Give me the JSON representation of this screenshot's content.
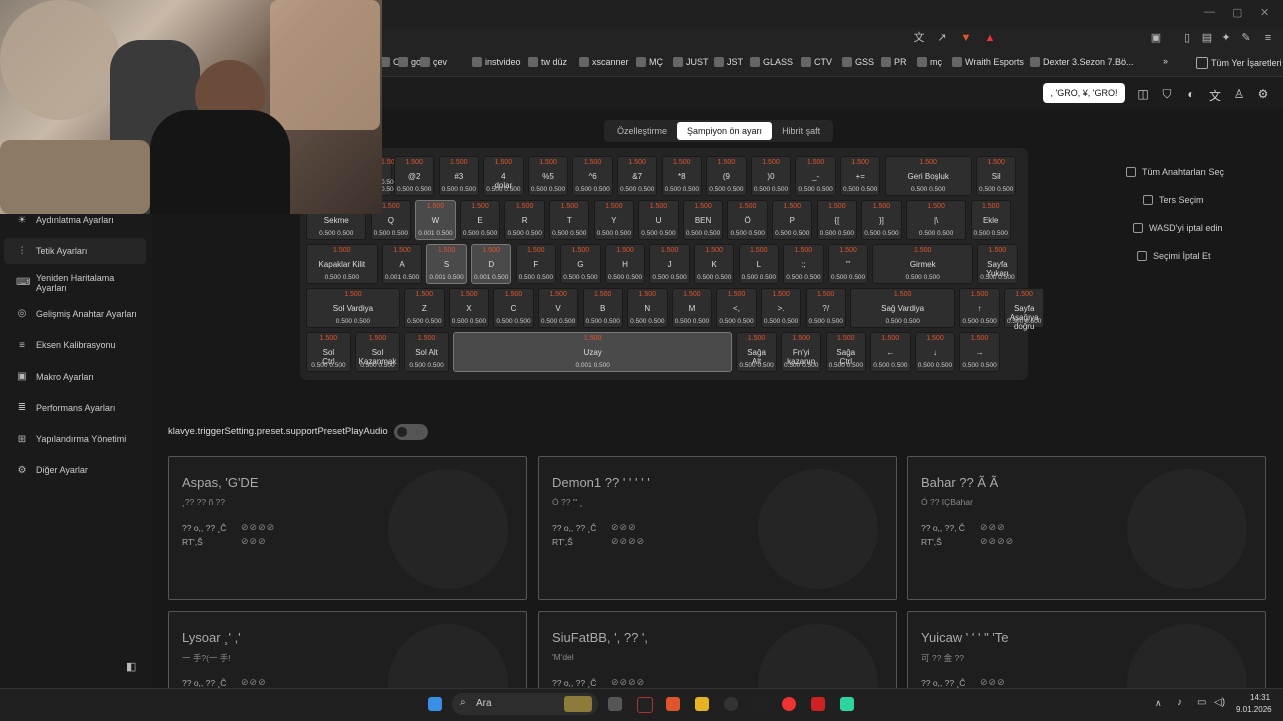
{
  "browser": {
    "bookmarks": [
      {
        "label": "C",
        "icon": "bookmark-icon"
      },
      {
        "label": "go",
        "icon": "google-icon"
      },
      {
        "label": "çev",
        "icon": "doc-icon"
      },
      {
        "label": "instvideo",
        "icon": "download-icon"
      },
      {
        "label": "tw düz",
        "icon": "globe-icon"
      },
      {
        "label": "xscanner",
        "icon": "scanner-icon"
      },
      {
        "label": "MÇ",
        "icon": "match-icon"
      },
      {
        "label": "JUST",
        "icon": "globe-icon"
      },
      {
        "label": "JST",
        "icon": "grid-icon"
      },
      {
        "label": "GLASS",
        "icon": "glass-icon"
      },
      {
        "label": "CTV",
        "icon": "tv-icon"
      },
      {
        "label": "GSS",
        "icon": "shirt-icon"
      },
      {
        "label": "PR",
        "icon": "p-icon"
      },
      {
        "label": "mç",
        "icon": "folder-icon"
      },
      {
        "label": "Wraith Esports",
        "icon": "wraith-icon"
      },
      {
        "label": "Dexter 3.Sezon 7.Bö...",
        "icon": "video-icon"
      }
    ],
    "more_bookmarks": "»",
    "all_bookmarks": "Tüm Yer İşaretleri"
  },
  "header": {
    "badge": ", 'GRO, ¥, 'GRO!"
  },
  "mode_tabs": [
    "Özelleştirme",
    "Şampiyon ön ayarı",
    "Hibrit şaft"
  ],
  "keyboard": {
    "rows": [
      [
        {
          "k": "",
          "v": "1.500",
          "r": "0.500 0.500",
          "w": 8
        },
        {
          "k": "@2",
          "v": "1.500",
          "r": "0.500 0.500"
        },
        {
          "k": "#3",
          "v": "1.500",
          "r": "0.500 0.500"
        },
        {
          "k": "4\ndolar",
          "v": "1.500",
          "r": "0.500 0.500"
        },
        {
          "k": "%5",
          "v": "1.500",
          "r": "0.500 0.500"
        },
        {
          "k": "^6",
          "v": "1.500",
          "r": "0.500 0.500"
        },
        {
          "k": "&7",
          "v": "1.500",
          "r": "0.500 0.500"
        },
        {
          "k": "*8",
          "v": "1.500",
          "r": "0.500 0.500"
        },
        {
          "k": "(9",
          "v": "1.500",
          "r": "0.500 0.500"
        },
        {
          "k": ")0",
          "v": "1.500",
          "r": "0.500 0.500"
        },
        {
          "k": "_-",
          "v": "1.500",
          "r": "0.500 0.500"
        },
        {
          "k": "+=",
          "v": "1.500",
          "r": "0.500 0.500"
        },
        {
          "k": "Geri Boşluk",
          "v": "1.500",
          "r": "0.500 0.500",
          "w": 2.05
        },
        {
          "k": "Sil",
          "v": "1.500",
          "r": "0.500 0.500"
        }
      ],
      [
        {
          "k": "Sekme",
          "v": "",
          "r": "0.500 0.500",
          "w": 1.45
        },
        {
          "k": "Q",
          "v": "1.500",
          "r": "0.500 0.500"
        },
        {
          "k": "W",
          "v": "1.500",
          "r": "0.001 0.500",
          "sel": true
        },
        {
          "k": "E",
          "v": "1.500",
          "r": "0.500 0.500"
        },
        {
          "k": "R",
          "v": "1.500",
          "r": "0.500 0.500"
        },
        {
          "k": "T",
          "v": "1.500",
          "r": "0.500 0.500"
        },
        {
          "k": "Y",
          "v": "1.500",
          "r": "0.500 0.500"
        },
        {
          "k": "U",
          "v": "1.500",
          "r": "0.500 0.500"
        },
        {
          "k": "BEN",
          "v": "1.500",
          "r": "0.500 0.500"
        },
        {
          "k": "Ö",
          "v": "1.500",
          "r": "0.500 0.500"
        },
        {
          "k": "P",
          "v": "1.500",
          "r": "0.500 0.500"
        },
        {
          "k": "{[",
          "v": "1.500",
          "r": "0.500 0.500"
        },
        {
          "k": "}]",
          "v": "1.500",
          "r": "0.500 0.500"
        },
        {
          "k": "|\\",
          "v": "1.500",
          "r": "0.500 0.500",
          "w": 1.45
        },
        {
          "k": "Ekle",
          "v": "1.500",
          "r": "0.500 0.500"
        }
      ],
      [
        {
          "k": "Kapaklar Kilit",
          "v": "1.500",
          "r": "0.500 0.500",
          "w": 1.7
        },
        {
          "k": "A",
          "v": "1.500",
          "r": "0.001 0.500"
        },
        {
          "k": "S",
          "v": "1.500",
          "r": "0.001 0.500",
          "sel": true
        },
        {
          "k": "D",
          "v": "1.500",
          "r": "0.001 0.500",
          "sel": true
        },
        {
          "k": "F",
          "v": "1.500",
          "r": "0.500 0.500"
        },
        {
          "k": "G",
          "v": "1.500",
          "r": "0.500 0.500"
        },
        {
          "k": "H",
          "v": "1.500",
          "r": "0.500 0.500"
        },
        {
          "k": "J",
          "v": "1.500",
          "r": "0.500 0.500"
        },
        {
          "k": "K",
          "v": "1.500",
          "r": "0.500 0.500"
        },
        {
          "k": "L",
          "v": "1.500",
          "r": "0.500 0.500"
        },
        {
          "k": ":;",
          "v": "1.500",
          "r": "0.500 0.500"
        },
        {
          "k": "\"'",
          "v": "1.500",
          "r": "0.500 0.500"
        },
        {
          "k": "Girmek",
          "v": "1.500",
          "r": "0.500 0.500",
          "w": 2.35
        },
        {
          "k": "Sayfa\nYukarı",
          "v": "1.500",
          "r": "0.500 0.500"
        }
      ],
      [
        {
          "k": "Sol Vardiya",
          "v": "1.500",
          "r": "0.500 0.500",
          "w": 2.2
        },
        {
          "k": "Z",
          "v": "1.500",
          "r": "0.500 0.500"
        },
        {
          "k": "X",
          "v": "1.500",
          "r": "0.500 0.500"
        },
        {
          "k": "C",
          "v": "1.500",
          "r": "0.500 0.500"
        },
        {
          "k": "V",
          "v": "1.500",
          "r": "0.500 0.500"
        },
        {
          "k": "B",
          "v": "1.500",
          "r": "0.500 0.500"
        },
        {
          "k": "N",
          "v": "1.500",
          "r": "0.500 0.500"
        },
        {
          "k": "M",
          "v": "1.500",
          "r": "0.500 0.500"
        },
        {
          "k": "<,",
          "v": "1.500",
          "r": "0.500 0.500"
        },
        {
          "k": ">.",
          "v": "1.500",
          "r": "0.500 0.500"
        },
        {
          "k": "?/",
          "v": "1.500",
          "r": "0.500 0.500"
        },
        {
          "k": "Sağ Vardiya",
          "v": "1.500",
          "r": "0.500 0.500",
          "w": 2.45
        },
        {
          "k": "↑",
          "v": "1.500",
          "r": "0.500 0.500"
        },
        {
          "k": "Sayfa\nAşağıya\ndoğru",
          "v": "1.500",
          "r": "0.500 0.500"
        }
      ],
      [
        {
          "k": "Sol\nCtrl",
          "v": "1.500",
          "r": "0.500 0.500",
          "w": 1.1
        },
        {
          "k": "Sol\nKazanmak",
          "v": "1.500",
          "r": "0.500 0.500",
          "w": 1.1
        },
        {
          "k": "Sol Alt",
          "v": "1.500",
          "r": "0.500 0.500",
          "w": 1.1
        },
        {
          "k": "Uzay",
          "v": "1.500",
          "r": "0.001 0.500",
          "w": 6.35,
          "sel": true
        },
        {
          "k": "Sağa\nAlt",
          "v": "1.500",
          "r": "0.500 0.500"
        },
        {
          "k": "Fn'yi\nkazanın",
          "v": "1.500",
          "r": "0.500 0.500"
        },
        {
          "k": "Sağa\nCtrl",
          "v": "1.500",
          "r": "0.500 0.500"
        },
        {
          "k": "←",
          "v": "1.500",
          "r": "0.500 0.500"
        },
        {
          "k": "↓",
          "v": "1.500",
          "r": "0.500 0.500"
        },
        {
          "k": "→",
          "v": "1.500",
          "r": "0.500 0.500"
        }
      ]
    ]
  },
  "right_panel": [
    {
      "label": "Tüm Anahtarları Seç",
      "icon": "select-all-icon"
    },
    {
      "label": "Ters Seçim",
      "icon": "invert-icon"
    },
    {
      "label": "WASD'yi iptal edin",
      "icon": "keyboard-icon"
    },
    {
      "label": "Seçimi İptal Et",
      "icon": "close-box-icon"
    }
  ],
  "sidebar": [
    {
      "label": "Aydınlatma Ayarları",
      "icon": "bulb-icon",
      "active": false
    },
    {
      "label": "Tetik Ayarları",
      "icon": "trigger-icon",
      "active": true
    },
    {
      "label": "Yeniden Haritalama Ayarları",
      "icon": "remap-icon",
      "active": false
    },
    {
      "label": "Gelişmiş Anahtar Ayarları",
      "icon": "advanced-key-icon",
      "active": false
    },
    {
      "label": "Eksen Kalibrasyonu",
      "icon": "axis-icon",
      "active": false
    },
    {
      "label": "Makro Ayarları",
      "icon": "macro-icon",
      "active": false
    },
    {
      "label": "Performans Ayarları",
      "icon": "performance-icon",
      "active": false
    },
    {
      "label": "Yapılandırma Yönetimi",
      "icon": "config-icon",
      "active": false
    },
    {
      "label": "Diğer Ayarlar",
      "icon": "other-settings-icon",
      "active": false
    }
  ],
  "toggle_label": "klavye.triggerSetting.preset.supportPresetPlayAudio",
  "cards": [
    {
      "title": "Aspas, 'G'DE",
      "subtitle": "¸?? ?? ñ ??",
      "line1": "?? o,, ?? ¸Ĉ",
      "line2": "RT',Š",
      "icons1": "⊘⊘⊘⊘",
      "icons2": "⊘⊘⊘"
    },
    {
      "title": "Demon1 ?? ' ' ' ' '",
      "subtitle": "Ó ?? \"' ¸",
      "line1": "?? o,, ?? ¸Ĉ",
      "line2": "RT',Š",
      "icons1": "⊘⊘⊘",
      "icons2": "⊘⊘⊘⊘"
    },
    {
      "title": "Bahar ?? Ã Ã",
      "subtitle": "Ó ?? IÇBahar",
      "line1": "?? o,, ??, Ĉ",
      "line2": "RT',Š",
      "icons1": "⊘⊘⊘",
      "icons2": "⊘⊘⊘⊘"
    },
    {
      "title": "Lysoar ¸' ,'",
      "subtitle": "一 手?(一 手!",
      "line1": "?? o,, ?? ¸Ĉ",
      "line2": "",
      "icons1": "⊘⊘⊘",
      "icons2": ""
    },
    {
      "title": "SiuFatBB, ', ?? ',",
      "subtitle": "'M'del",
      "line1": "?? o,, ?? ¸Ĉ",
      "line2": "",
      "icons1": "⊘⊘⊘⊘",
      "icons2": ""
    },
    {
      "title": "Yuicaw ' ' ' \" 'Te",
      "subtitle": "可 ?? 金 ??",
      "line1": "?? o,, ?? ¸Ĉ",
      "line2": "",
      "icons1": "⊘⊘⊘",
      "icons2": ""
    }
  ],
  "taskbar": {
    "search": "Ara",
    "time": "14:31",
    "date": "9.01.2026"
  }
}
